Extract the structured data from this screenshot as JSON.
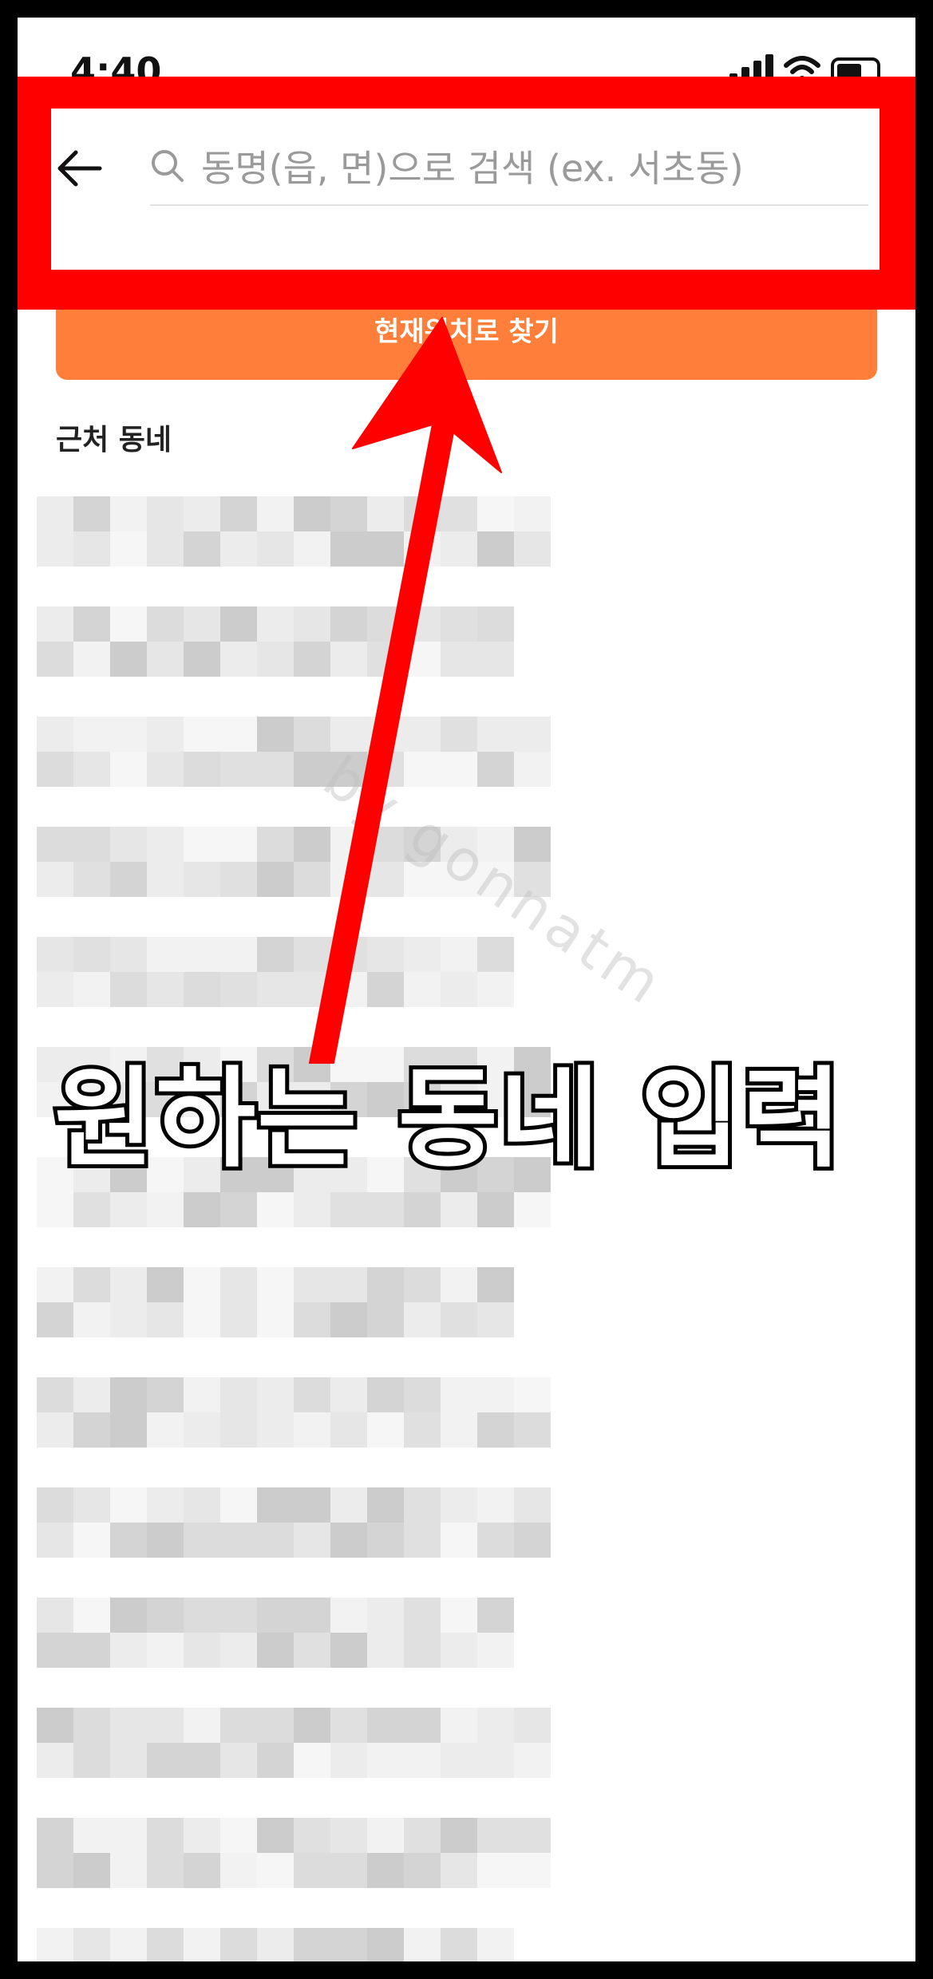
{
  "status_bar": {
    "time": "4:40"
  },
  "search": {
    "back_icon": "back-arrow-icon",
    "search_icon": "search-icon",
    "placeholder": "동명(읍, 면)으로 검색 (ex. 서초동)"
  },
  "current_location_button": {
    "label": "현재위치로 찾기"
  },
  "nearby": {
    "title": "근처 동네"
  },
  "watermark": "by gonnatm",
  "annotation": {
    "caption": "원하는 동네 입력"
  },
  "colors": {
    "highlight": "#ff0000",
    "accent_orange": "#ff7f3a"
  }
}
